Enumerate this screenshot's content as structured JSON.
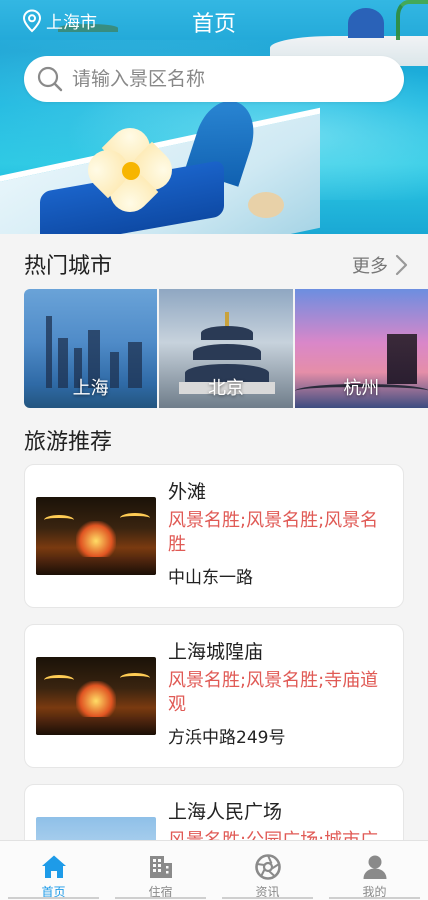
{
  "header": {
    "location": "上海市",
    "title": "首页"
  },
  "search": {
    "placeholder": "请输入景区名称",
    "value": ""
  },
  "hot_cities": {
    "heading": "热门城市",
    "more_label": "更多",
    "items": [
      {
        "name": "上海"
      },
      {
        "name": "北京"
      },
      {
        "name": "杭州"
      }
    ]
  },
  "recommend": {
    "heading": "旅游推荐",
    "items": [
      {
        "title": "外滩",
        "tags": "风景名胜;风景名胜;风景名胜",
        "address": "中山东一路"
      },
      {
        "title": "上海城隍庙",
        "tags": "风景名胜;风景名胜;寺庙道观",
        "address": "方浜中路249号"
      },
      {
        "title": "上海人民广场",
        "tags": "风景名胜;公园广场;城市广",
        "address": ""
      }
    ]
  },
  "tabbar": {
    "items": [
      {
        "label": "首页",
        "icon": "home-icon",
        "active": true
      },
      {
        "label": "住宿",
        "icon": "building-icon",
        "active": false
      },
      {
        "label": "资讯",
        "icon": "aperture-icon",
        "active": false
      },
      {
        "label": "我的",
        "icon": "user-icon",
        "active": false
      }
    ]
  },
  "colors": {
    "accent": "#1e9be8",
    "tag_red": "#e05a55",
    "hero_sea": "#1fa6d6"
  }
}
